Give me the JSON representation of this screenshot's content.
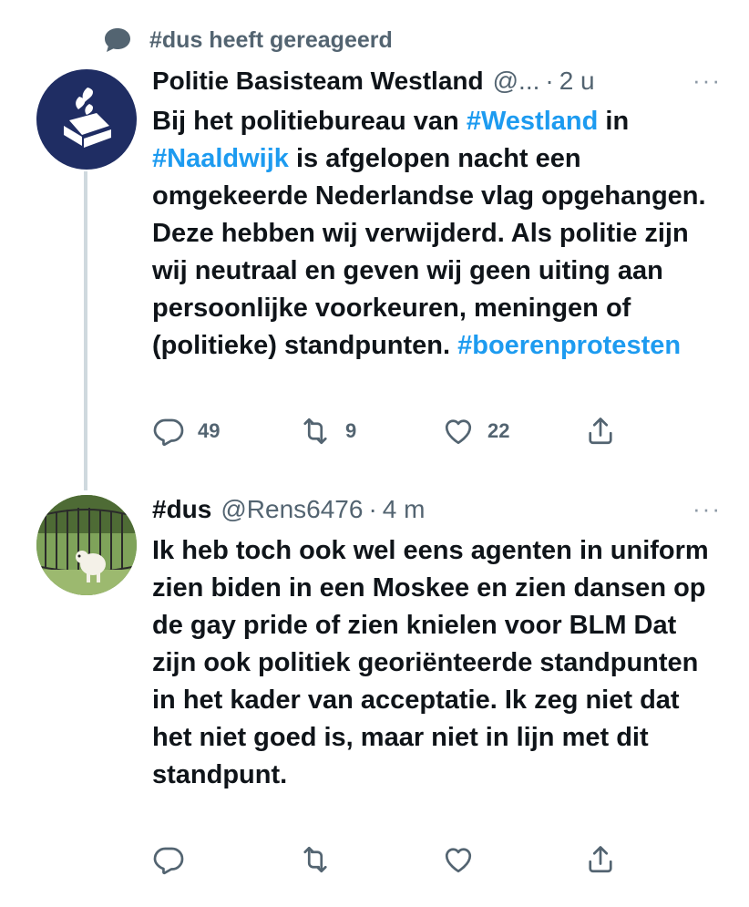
{
  "context": {
    "text": "#dus heeft gereageerd",
    "icon": "speech-bubble-icon"
  },
  "tweets": [
    {
      "avatar": "police-logo-avatar",
      "name": "Politie Basisteam Westland",
      "handle": "@...",
      "sep": "·",
      "time": "2 u",
      "more": "···",
      "text": [
        {
          "t": "Bij het politiebureau van "
        },
        {
          "t": "#Westland",
          "tag": true
        },
        {
          "t": " in "
        },
        {
          "t": "#Naaldwijk",
          "tag": true
        },
        {
          "t": " is afgelopen nacht een omgekeerde Nederlandse vlag opgehangen. Deze hebben wij verwijderd. Als politie zijn wij neutraal en geven wij geen uiting aan persoonlijke voorkeuren, meningen of (politieke) standpunten. "
        },
        {
          "t": "#boerenprotesten",
          "tag": true
        }
      ],
      "actions": {
        "replies": "49",
        "retweets": "9",
        "likes": "22",
        "share": ""
      }
    },
    {
      "avatar": "user-photo-avatar",
      "name": "#dus",
      "handle": "@Rens6476",
      "sep": "·",
      "time": "4 m",
      "more": "···",
      "text": [
        {
          "t": "Ik heb toch ook wel eens agenten  in uniform zien biden in een Moskee en zien dansen op de gay pride of zien knielen voor BLM Dat zijn ook politiek georiënteerde standpunten in het kader van acceptatie. Ik zeg niet dat het niet goed is, maar niet in lijn met dit standpunt."
        }
      ],
      "actions": {
        "replies": "",
        "retweets": "",
        "likes": "",
        "share": ""
      }
    }
  ],
  "colors": {
    "link": "#1d9bf0",
    "muted": "#536471",
    "text": "#0f1419",
    "thread": "#cfd9de",
    "police_navy": "#1f2d63"
  }
}
